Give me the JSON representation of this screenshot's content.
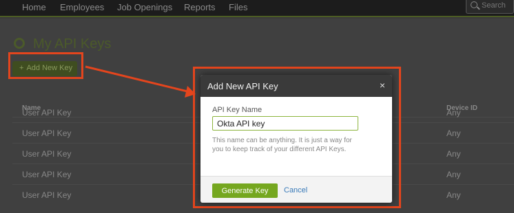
{
  "nav": {
    "items": [
      "Home",
      "Employees",
      "Job Openings",
      "Reports",
      "Files"
    ],
    "search_placeholder": "Search"
  },
  "page": {
    "title": "My API Keys",
    "add_button_label": "Add New Key",
    "table": {
      "headers": {
        "name": "Name",
        "device": "Device ID"
      },
      "rows": [
        {
          "name": "User API Key",
          "device": "Any"
        },
        {
          "name": "User API Key",
          "device": "Any"
        },
        {
          "name": "User API Key",
          "device": "Any"
        },
        {
          "name": "User API Key",
          "device": "Any"
        },
        {
          "name": "User API Key",
          "device": "Any"
        }
      ]
    }
  },
  "modal": {
    "title": "Add New API Key",
    "close_glyph": "×",
    "field_label": "API Key Name",
    "field_value": "Okta API key",
    "help_text": "This name can be anything. It is just a way for you to keep track of your different API Keys.",
    "generate_label": "Generate Key",
    "cancel_label": "Cancel"
  },
  "colors": {
    "annotation": "#e4451d",
    "accent_green": "#75a71f",
    "link_blue": "#3779b8"
  }
}
